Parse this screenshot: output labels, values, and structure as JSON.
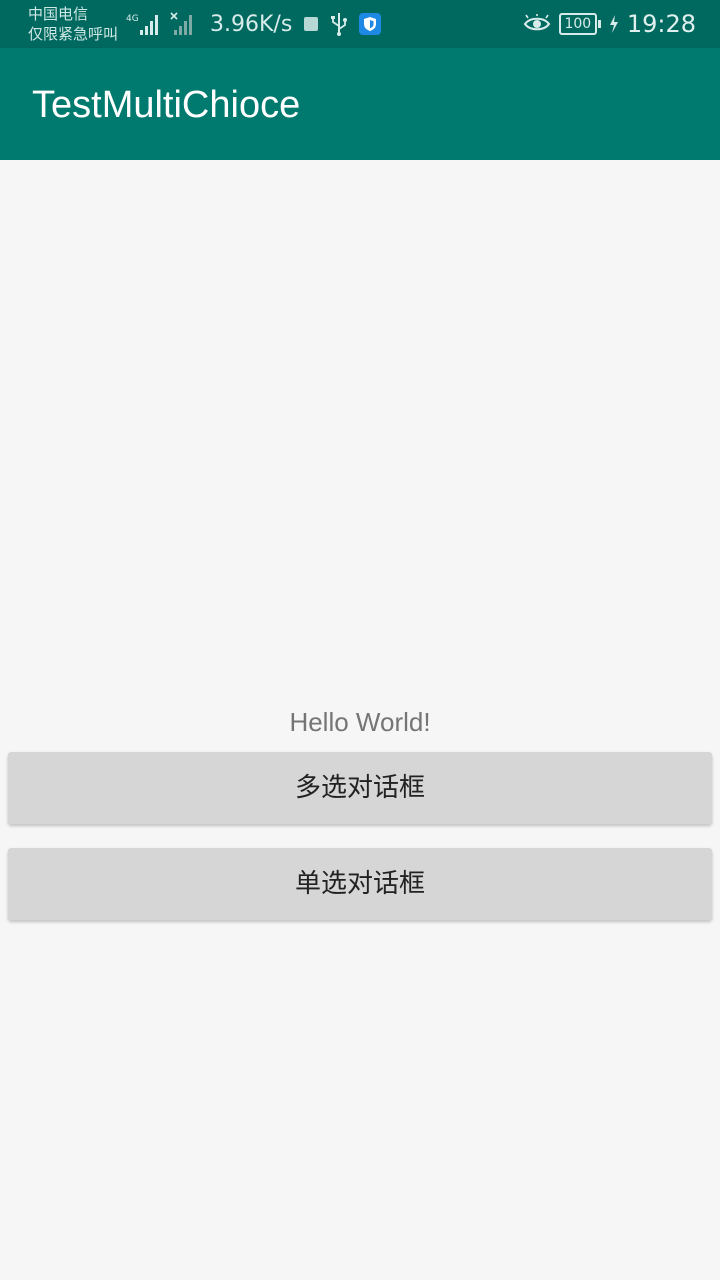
{
  "status_bar": {
    "carrier_line1": "中国电信",
    "carrier_line2": "仅限紧急呼叫",
    "network_type": "4G",
    "net_speed": "3.96K/s",
    "battery_level": "100",
    "time": "19:28",
    "icons": [
      "signal-icon",
      "no-signal-icon",
      "notification-square-icon",
      "usb-icon",
      "shield-icon",
      "eye-icon",
      "battery-icon",
      "charging-icon"
    ]
  },
  "app_bar": {
    "title": "TestMultiChioce"
  },
  "main": {
    "hello_text": "Hello World!",
    "multi_choice_button": "多选对话框",
    "single_choice_button": "单选对话框"
  },
  "colors": {
    "status_bar": "#00695f",
    "app_bar": "#00796f",
    "background": "#f6f6f6",
    "button": "#d7d6d7"
  }
}
